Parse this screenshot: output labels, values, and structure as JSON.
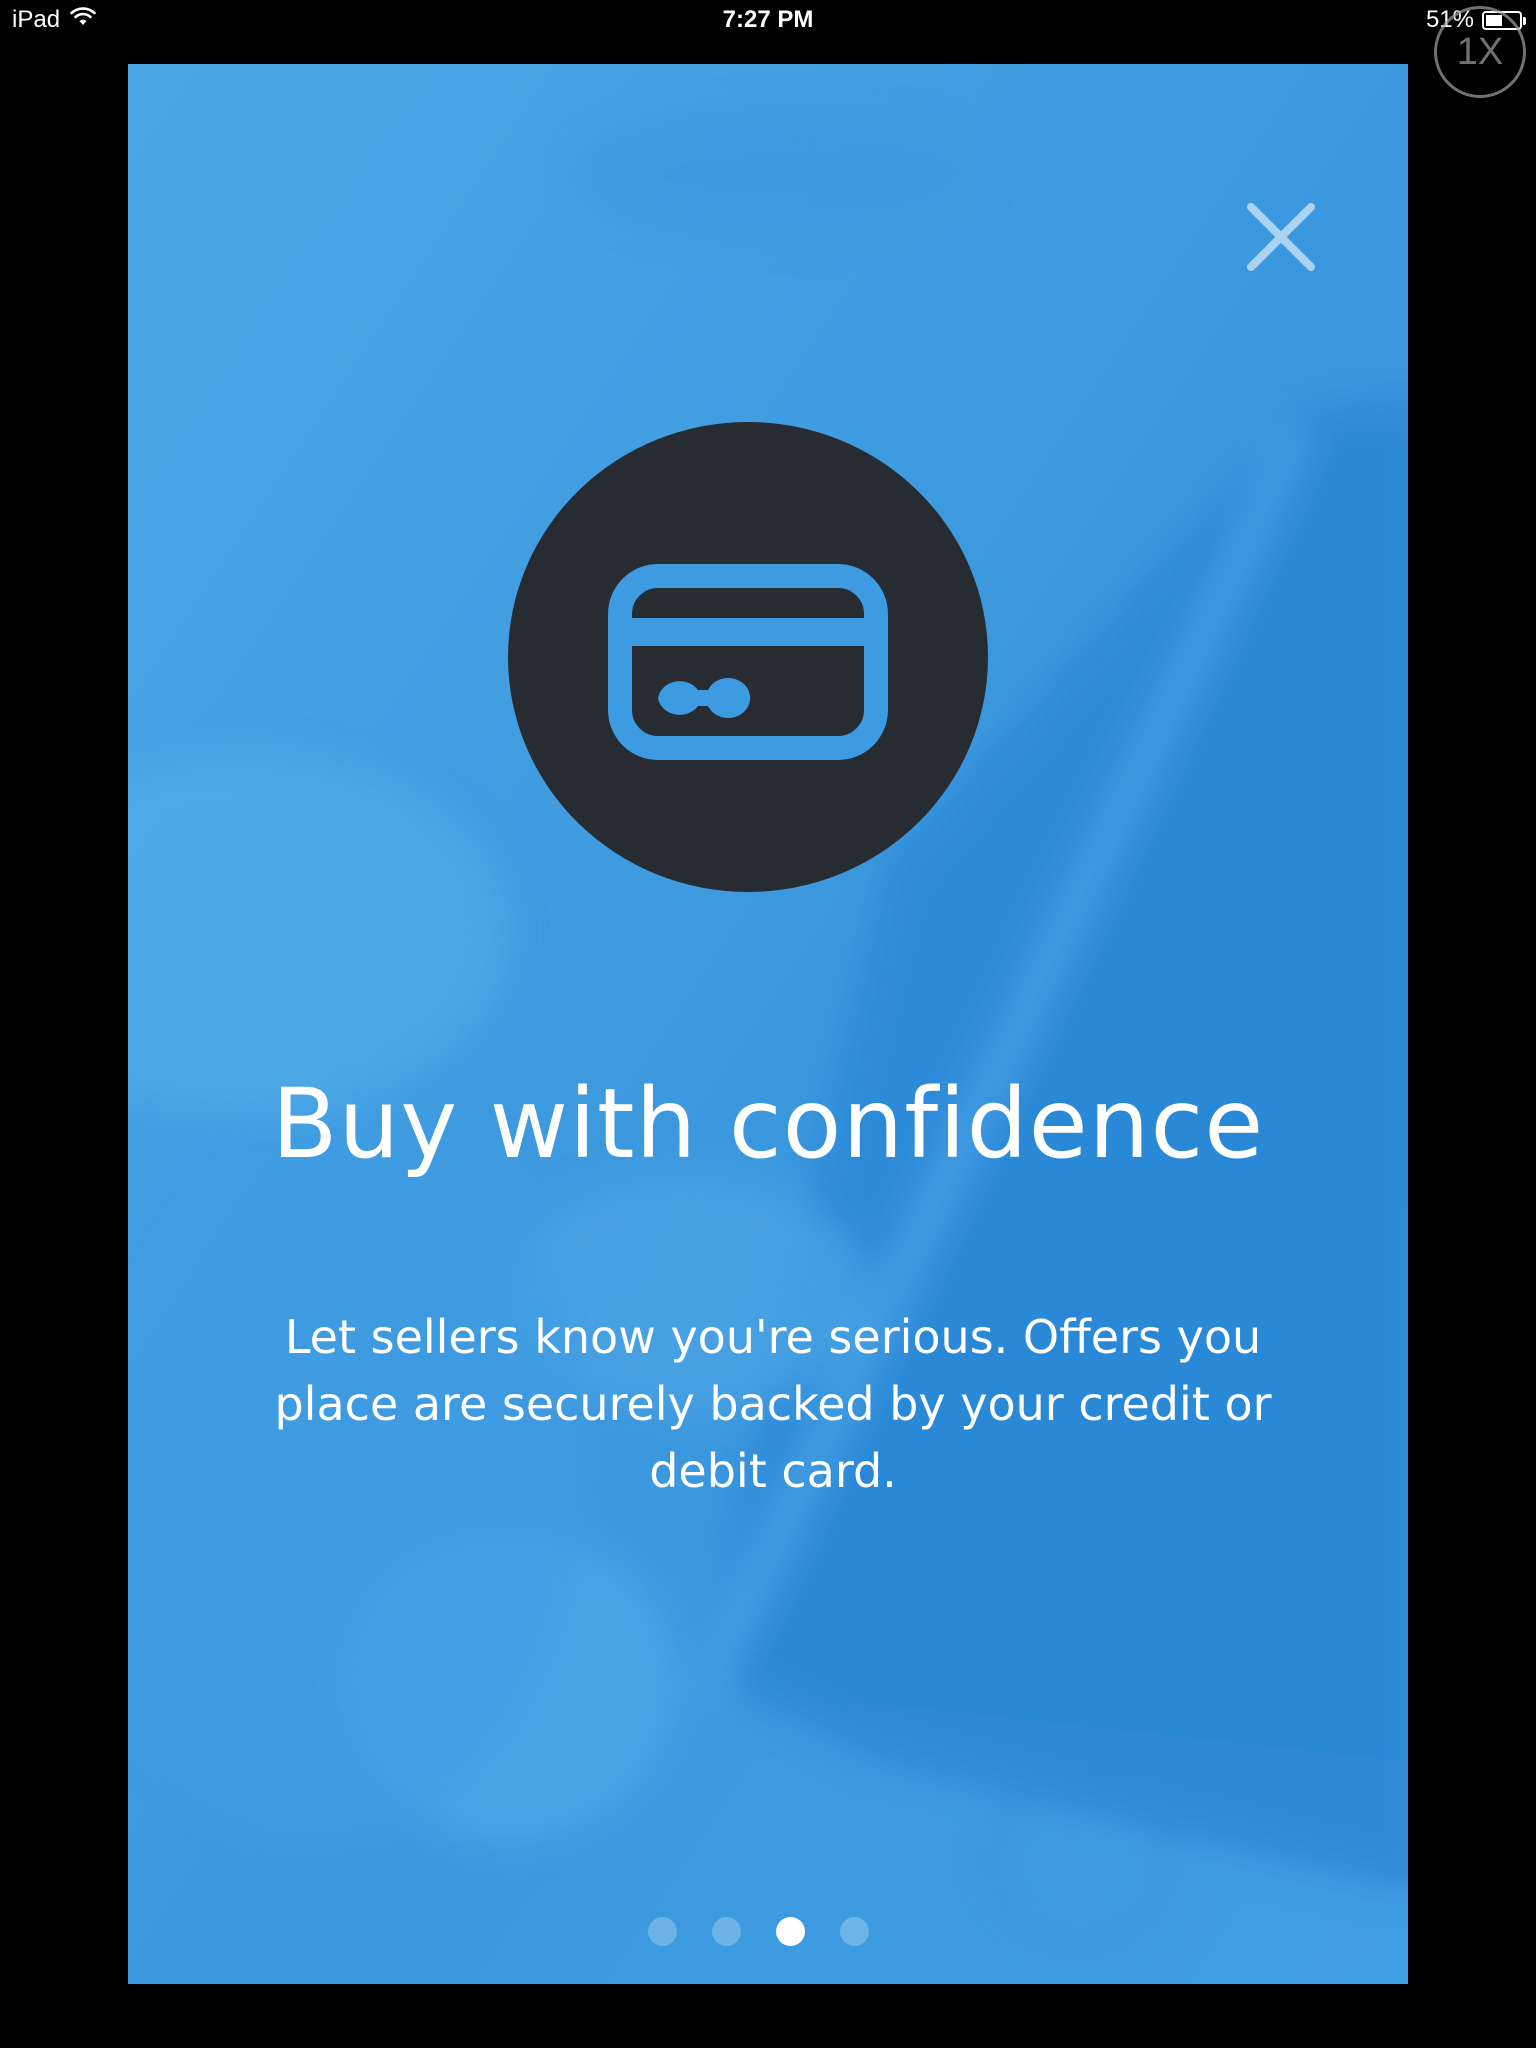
{
  "status_bar": {
    "device": "iPad",
    "time": "7:27 PM",
    "battery_percent": "51%",
    "battery_level": 0.51,
    "zoom_badge": "1X"
  },
  "onboarding": {
    "close_icon": "close-icon",
    "feature_icon": "credit-card-icon",
    "title": "Buy with confidence",
    "description": "Let sellers know you're serious. Offers you place are securely backed by your credit or debit card.",
    "page_indicator": {
      "total_pages": 4,
      "current_page": 3
    }
  },
  "colors": {
    "background_blue": "#3d9be2",
    "icon_circle": "#272c33",
    "text": "#ffffff"
  }
}
